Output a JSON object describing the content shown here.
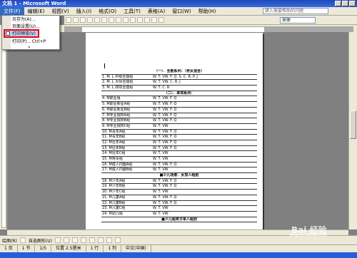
{
  "window": {
    "title": "文档 1 - Microsoft Word"
  },
  "menubar": {
    "items": [
      "文件(F)",
      "编辑(E)",
      "视图(V)",
      "插入(I)",
      "格式(O)",
      "工具(T)",
      "表格(A)",
      "窗口(W)",
      "帮助(H)"
    ]
  },
  "help_box": {
    "placeholder": "键入需要帮助的问题"
  },
  "font": {
    "name": "宋体"
  },
  "file_menu": {
    "items": [
      "另存为(A)...",
      "页面设置(U)...",
      "打印预览(V)",
      "打印(P)...   Ctrl+P"
    ],
    "expand": "»"
  },
  "document": {
    "rows": [
      {
        "a": "（一）．全能系列：（男女混合）",
        "b": "",
        "section": true
      },
      {
        "a": "1. M. L 中级全能组",
        "b": "W. T. VW. F. Q. S. C. R. P. J"
      },
      {
        "a": "2. M. L 大师全能组",
        "b": "W. T. VW. C. R. J"
      },
      {
        "a": "3. M. L 四项全能组",
        "b": "W. T. C. R"
      },
      {
        "a": "（二）．单项系列：",
        "b": "",
        "section": true
      },
      {
        "a": "4. M职业组",
        "b": "W. T. VW. F. Q"
      },
      {
        "a": "5. M职业新星A组",
        "b": "W. T. VW. F. Q"
      },
      {
        "a": "6. M职业新星B组",
        "b": "W. T. VW. F. Q"
      },
      {
        "a": "7. M专业院校A组",
        "b": "W. T. VW. F. Q"
      },
      {
        "a": "8. M专业院校B组",
        "b": "W. T. VW. F. Q"
      },
      {
        "a": "9. M专业院校C组",
        "b": "W. T. VW"
      },
      {
        "a": "10. M青年A组",
        "b": "W. T. VW. F. Q"
      },
      {
        "a": "11. M青年B组",
        "b": "W. T. VW. F. Q"
      },
      {
        "a": "12. M壮年A组",
        "b": "W. T. VW. F. Q"
      },
      {
        "a": "13. M壮年B组",
        "b": "W. T. VW. F. Q"
      },
      {
        "a": "14. M壮年C组",
        "b": "W. T. VW"
      },
      {
        "a": "15. M常青组",
        "b": "W. T. VW"
      },
      {
        "a": "16. M成人円面A组",
        "b": "W. T. VW. F. Q"
      },
      {
        "a": "17. M成人円面B组",
        "b": "W. T. VW"
      },
      {
        "a": "■少儿场景．女双人组别",
        "b": "",
        "section": true
      },
      {
        "a": "18. M少年A组",
        "b": "W. T. VW. F. Q"
      },
      {
        "a": "19. M少年B组",
        "b": "W. T. VW. F. Q"
      },
      {
        "a": "20. M少年C组",
        "b": "W. T. VW"
      },
      {
        "a": "21. M儿童A组",
        "b": "W. T. VW. F. Q"
      },
      {
        "a": "22. M儿童B组",
        "b": "W. T. VW. F. Q"
      },
      {
        "a": "23. M儿童C组",
        "b": "W. T. VW"
      },
      {
        "a": "24. M幼儿组",
        "b": "W. T. VW"
      },
      {
        "a": "■少儿组男子单人组别",
        "b": "",
        "section": true
      }
    ]
  },
  "drawbar": {
    "draw": "绘图(R)",
    "autoshapes": "自选图形(U)"
  },
  "status": {
    "page": "1 页",
    "section": "1 节",
    "pages": "1/5",
    "position": "位置 2.5厘米",
    "line": "1 行",
    "col": "1 列",
    "lang": "中文(中国)"
  },
  "watermark": {
    "text": "Bai 经验",
    "sub": "jingyan.baidu.com"
  }
}
